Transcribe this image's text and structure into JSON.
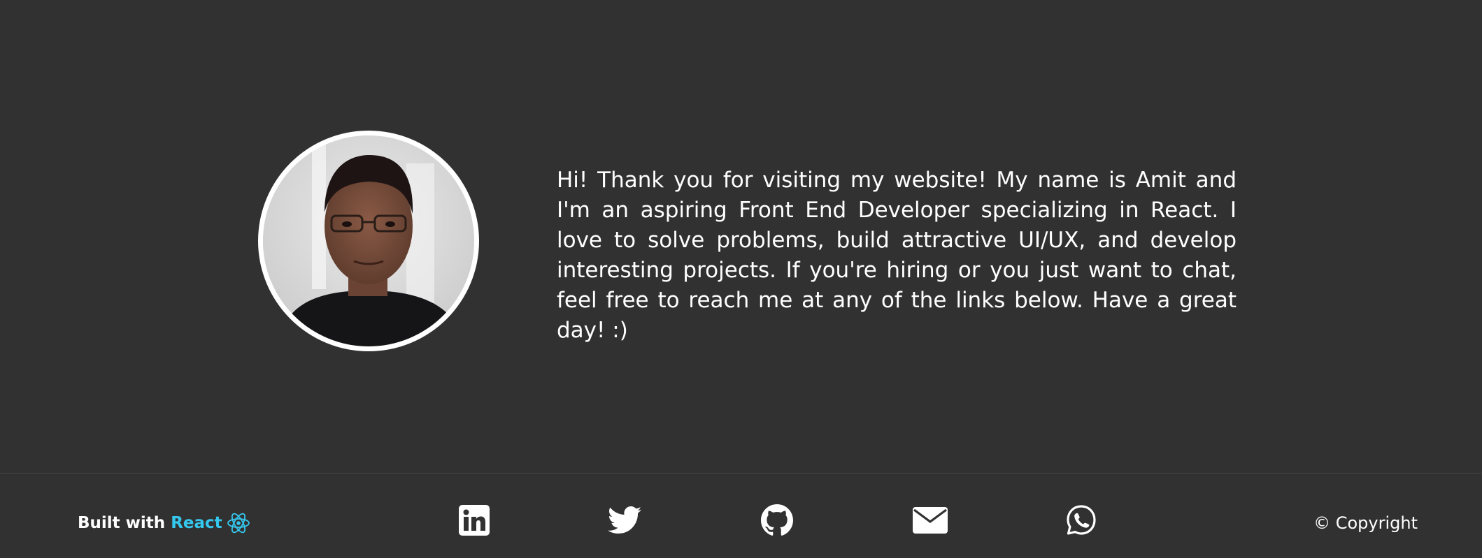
{
  "bio": {
    "text": "Hi! Thank you for visiting my website! My name is Amit and I'm an aspiring Front End Developer specializing in React. I love to solve problems, build attractive UI/UX, and develop interesting projects. If you're hiring or you just want to chat, feel free to reach me at any of the links below. Have a great day! :)"
  },
  "footer": {
    "built_with": "Built with",
    "react_label": "React",
    "copyright": "© Copyright",
    "social_icons": [
      "linkedin-icon",
      "twitter-icon",
      "github-icon",
      "email-icon",
      "whatsapp-icon"
    ]
  },
  "colors": {
    "background": "#313131",
    "text": "#ffffff",
    "react_accent": "#35c8ef",
    "divider": "#454545"
  }
}
